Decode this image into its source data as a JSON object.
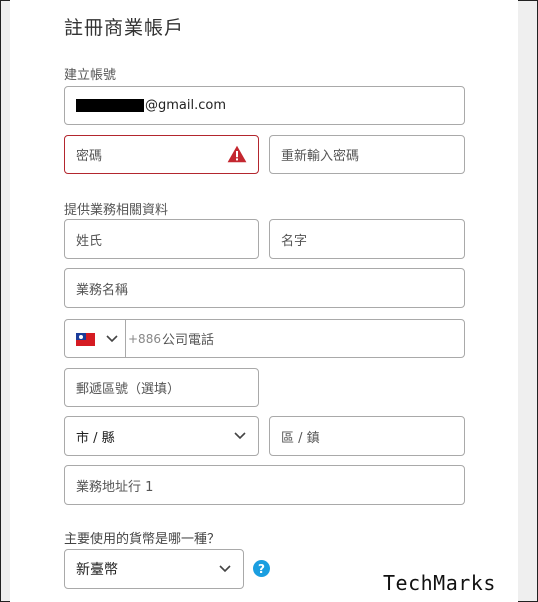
{
  "page": {
    "title": "註冊商業帳戶"
  },
  "account": {
    "section_label": "建立帳號",
    "email_suffix": "@gmail.com",
    "password_placeholder": "密碼",
    "confirm_password_placeholder": "重新輸入密碼"
  },
  "business": {
    "section_label": "提供業務相關資料",
    "last_name_placeholder": "姓氏",
    "first_name_placeholder": "名字",
    "business_name_placeholder": "業務名稱",
    "phone_code": "+886",
    "phone_placeholder": "公司電話",
    "postal_placeholder": "郵遞區號（選填）",
    "city_placeholder": "市 / 縣",
    "district_placeholder": "區 / 鎮",
    "address_placeholder": "業務地址行 1"
  },
  "currency": {
    "question": "主要使用的貨幣是哪一種？",
    "selected": "新臺幣",
    "help_label": "?"
  },
  "watermark": {
    "brand": "TechMarks"
  },
  "colors": {
    "error_border": "#b3262e",
    "warning_icon": "#c4272f",
    "help_icon": "#1a9ee0"
  }
}
